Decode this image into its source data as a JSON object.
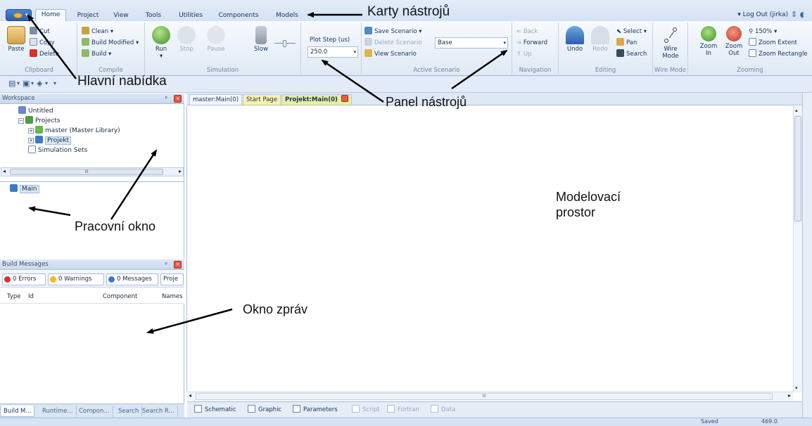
{
  "app": {
    "ribbon_tabs": [
      "Home",
      "Project",
      "View",
      "Tools",
      "Utilities",
      "Components",
      "Models"
    ],
    "active_tab": "Home",
    "user": "Log Out (jirka)"
  },
  "ribbon": {
    "clipboard": {
      "label": "Clipboard",
      "paste": "Paste",
      "cut": "Cut",
      "copy": "Copy",
      "delete": "Delete"
    },
    "compile": {
      "label": "Compile",
      "clean": "Clean",
      "build_modified": "Build Modified",
      "build": "Build"
    },
    "simulation": {
      "label": "Simulation",
      "run": "Run",
      "stop": "Stop",
      "pause": "Pause",
      "slow": "Slow",
      "plot_step_label": "Plot Step (us)",
      "plot_step_value": "250.0"
    },
    "active_scenario": {
      "label": "Active Scenario",
      "save": "Save Scenario",
      "delete": "Delete Scenario",
      "view": "View Scenario",
      "scenario_value": "Base"
    },
    "navigation": {
      "label": "Navigation",
      "back": "Back",
      "forward": "Forward",
      "up": "Up"
    },
    "editing": {
      "label": "Editing",
      "undo": "Undo",
      "redo": "Redo",
      "select": "Select",
      "pan": "Pan",
      "search": "Search"
    },
    "wire_mode": {
      "label": "Wire Mode",
      "button_line1": "Wire",
      "button_line2": "Mode"
    },
    "zooming": {
      "label": "Zooming",
      "zoom_in_line1": "Zoom",
      "zoom_in_line2": "In",
      "zoom_out_line1": "Zoom",
      "zoom_out_line2": "Out",
      "zoom_level": "150%",
      "zoom_extent": "Zoom Extent",
      "zoom_rectangle": "Zoom Rectangle"
    }
  },
  "workspace": {
    "title": "Workspace",
    "tree": [
      {
        "label": "Untitled"
      },
      {
        "label": "Projects"
      },
      {
        "label": "master (Master Library)"
      },
      {
        "label": "Projekt"
      },
      {
        "label": "Simulation Sets"
      }
    ],
    "scroll_glyph": "III",
    "definitions": [
      "Main"
    ]
  },
  "build_messages": {
    "title": "Build Messages",
    "errors": "0 Errors",
    "warnings": "0 Warnings",
    "messages": "0 Messages",
    "project_cut": "Proje",
    "columns": [
      "Type",
      "Id",
      "Component",
      "Names"
    ],
    "bottom_tabs": [
      "Build M...",
      "Runtime...",
      "Compon...",
      "Search",
      "Search R..."
    ]
  },
  "document": {
    "tabs": [
      "master:Main(0)",
      "Start Page",
      "Projekt:Main(0)"
    ],
    "scroll_glyph": "III",
    "view_tabs": [
      "Schematic",
      "Graphic",
      "Parameters",
      "Script",
      "Fortran",
      "Data"
    ]
  },
  "status": {
    "left": "Saved",
    "right": "469.0"
  },
  "annotations": {
    "karty": "Karty nástrojů",
    "hlavni": "Hlavní nabídka",
    "panel": "Panel nástrojů",
    "pracovni": "Pracovní okno",
    "modelovaci_line1": "Modelovací",
    "modelovaci_line2": "prostor",
    "okno": "Okno zpráv"
  },
  "colors": {
    "accent": "#2a5fae",
    "ribbon": "#dfe9f5",
    "annotation": "#111111"
  }
}
